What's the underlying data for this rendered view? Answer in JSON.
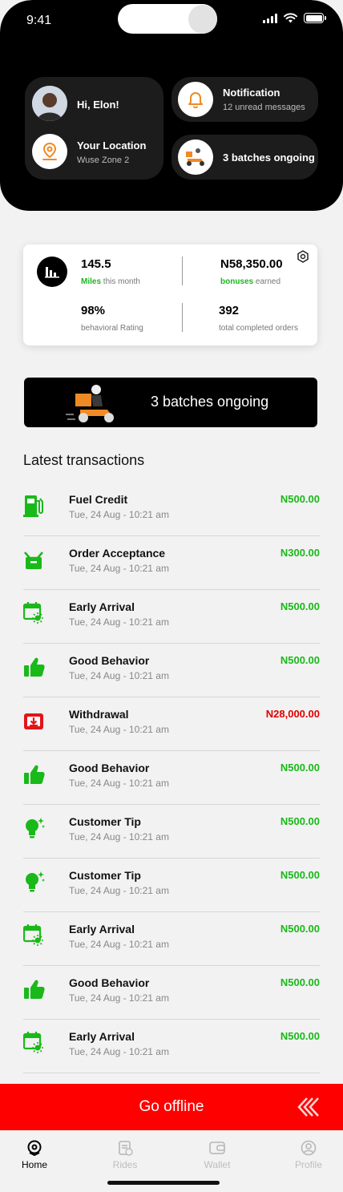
{
  "status": {
    "time": "9:41"
  },
  "header": {
    "greeting": "Hi, Elon!",
    "location_title": "Your Location",
    "location_value": "Wuse Zone 2",
    "notification_title": "Notification",
    "notification_sub": "12 unread messages",
    "batches_card": "3 batches ongoing"
  },
  "stats": {
    "miles_value": "145.5",
    "miles_label_strong": "Miles",
    "miles_label": " this month",
    "bonus_value": "N58,350.00",
    "bonus_label_strong": "bonuses",
    "bonus_label": " earned",
    "rating_value": "98%",
    "rating_label": "behavioral Rating",
    "orders_value": "392",
    "orders_label": "total completed orders"
  },
  "banner": {
    "label": "3 batches ongoing"
  },
  "transactions_title": "Latest transactions",
  "transactions": [
    {
      "title": "Fuel Credit",
      "date": "Tue, 24 Aug - 10:21 am",
      "amount": "N500.00",
      "icon": "fuel-pump-icon"
    },
    {
      "title": "Order Acceptance",
      "date": "Tue, 24 Aug - 10:21 am",
      "amount": "N300.00",
      "icon": "basket-icon"
    },
    {
      "title": "Early Arrival",
      "date": "Tue, 24 Aug - 10:21 am",
      "amount": "N500.00",
      "icon": "calendar-sun-icon"
    },
    {
      "title": "Good Behavior",
      "date": "Tue, 24 Aug - 10:21 am",
      "amount": "N500.00",
      "icon": "thumbs-up-icon"
    },
    {
      "title": "Withdrawal",
      "date": "Tue, 24 Aug - 10:21 am",
      "amount": "N28,000.00",
      "icon": "withdraw-icon"
    },
    {
      "title": "Good Behavior",
      "date": "Tue, 24 Aug - 10:21 am",
      "amount": "N500.00",
      "icon": "thumbs-up-icon"
    },
    {
      "title": "Customer Tip",
      "date": "Tue, 24 Aug - 10:21 am",
      "amount": "N500.00",
      "icon": "lightbulb-icon"
    },
    {
      "title": "Customer Tip",
      "date": "Tue, 24 Aug - 10:21 am",
      "amount": "N500.00",
      "icon": "lightbulb-icon"
    },
    {
      "title": "Early Arrival",
      "date": "Tue, 24 Aug - 10:21 am",
      "amount": "N500.00",
      "icon": "calendar-sun-icon"
    },
    {
      "title": "Good Behavior",
      "date": "Tue, 24 Aug - 10:21 am",
      "amount": "N500.00",
      "icon": "thumbs-up-icon"
    },
    {
      "title": "Early Arrival",
      "date": "Tue, 24 Aug - 10:21 am",
      "amount": "N500.00",
      "icon": "calendar-sun-icon"
    }
  ],
  "offline_button": "Go offline",
  "nav": {
    "home": "Home",
    "rides": "Rides",
    "wallet": "Wallet",
    "profile": "Profile"
  },
  "colors": {
    "accent_green": "#19b919",
    "alert_red": "#ff0000",
    "orange": "#f08a24"
  }
}
